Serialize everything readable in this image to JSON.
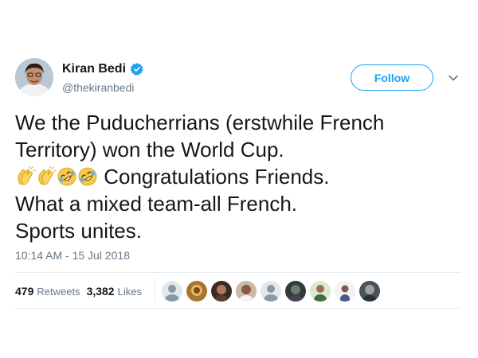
{
  "author": {
    "name": "Kiran Bedi",
    "handle": "@thekiranbedi",
    "verified": true
  },
  "follow_button": {
    "label": "Follow"
  },
  "tweet": {
    "lines": [
      "We the Puducherrians (erstwhile French",
      "Territory) won the World Cup.",
      "Congratulations Friends.",
      "What a mixed team-all French.",
      "Sports unites."
    ],
    "emojis": [
      "clapping-hands",
      "clapping-hands",
      "rolling-on-floor-laughing",
      "rolling-on-floor-laughing"
    ]
  },
  "timestamp": "10:14 AM - 15 Jul 2018",
  "stats": {
    "retweets_count": "479",
    "retweets_label": "Retweets",
    "likes_count": "3,382",
    "likes_label": "Likes"
  },
  "likers_count_shown": 9,
  "colors": {
    "accent": "#1da1f2",
    "text": "#14171a",
    "secondary": "#657786",
    "divider": "#e6ecf0"
  }
}
